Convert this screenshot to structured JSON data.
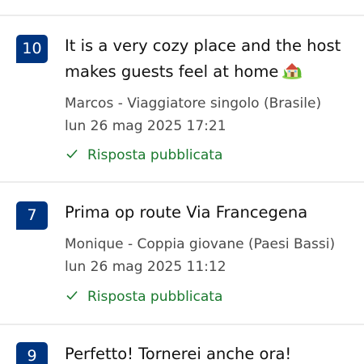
{
  "reviews": [
    {
      "score": "10",
      "title": "It is a very cozy place and the host makes guests feel at home",
      "title_emoji": "house-with-garden-icon",
      "author": "Marcos - Viaggiatore singolo (Brasile)",
      "date": "lun 26 mag 2025 17:21",
      "response_status": "Risposta pubblicata"
    },
    {
      "score": "7",
      "title": "Prima op route Via Francegena",
      "author": "Monique - Coppia giovane (Paesi Bassi)",
      "date": "lun 26 mag 2025 11:12",
      "response_status": "Risposta pubblicata"
    },
    {
      "score": "9",
      "title": "Perfetto! Tornerei anche ora!"
    }
  ],
  "colors": {
    "score_badge": "#003580",
    "response_text": "#1b7a2f",
    "meta_text": "#4a4a4a"
  }
}
